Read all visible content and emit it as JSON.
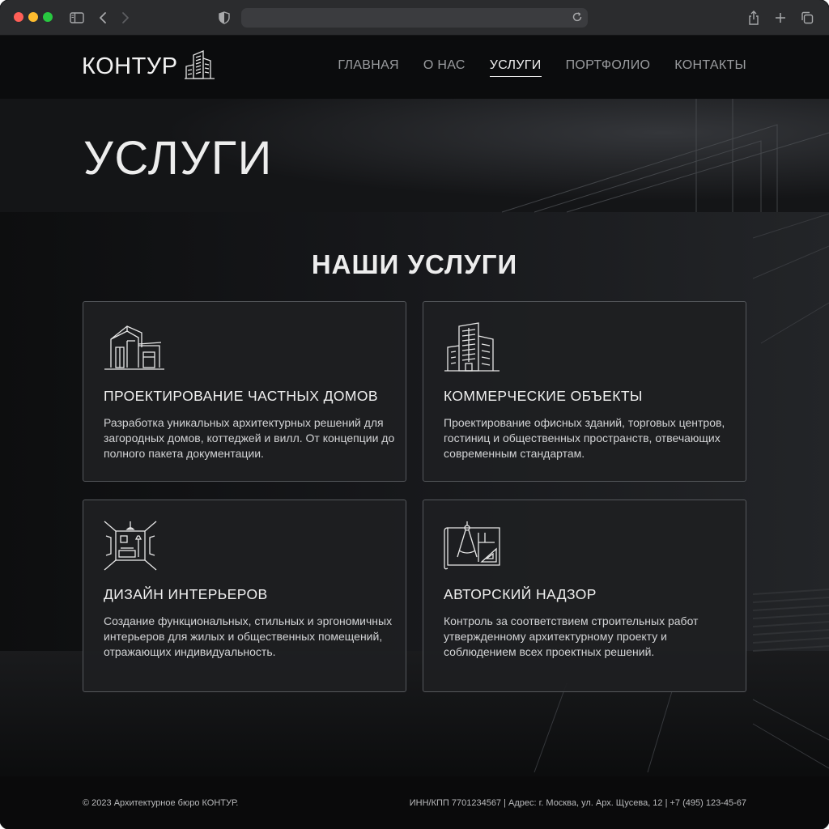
{
  "browser": {
    "url_text": ""
  },
  "header": {
    "logo_text": "КОНТУР",
    "nav": [
      {
        "label": "ГЛАВНАЯ",
        "active": false
      },
      {
        "label": "О НАС",
        "active": false
      },
      {
        "label": "УСЛУГИ",
        "active": true
      },
      {
        "label": "ПОРТФОЛИО",
        "active": false
      },
      {
        "label": "КОНТАКТЫ",
        "active": false
      }
    ]
  },
  "hero": {
    "title": "УСЛУГИ"
  },
  "services": {
    "title": "НАШИ УСЛУГИ",
    "items": [
      {
        "icon": "house-icon",
        "title": "ПРОЕКТИРОВАНИЕ ЧАСТНЫХ ДОМОВ",
        "text": "Разработка уникальных архитектурных решений для загородных домов, коттеджей и вилл. От концепции до полного пакета документации."
      },
      {
        "icon": "office-building-icon",
        "title": "КОММЕРЧЕСКИЕ ОБЪЕКТЫ",
        "text": "Проектирование офисных зданий, торговых центров, гостиниц и общественных пространств, отвечающих современным стандартам."
      },
      {
        "icon": "interior-room-icon",
        "title": "ДИЗАЙН ИНТЕРЬЕРОВ",
        "text": "Создание функциональных, стильных и эргономичных интерьеров для жилых и общественных помещений, отражающих индивидуальность."
      },
      {
        "icon": "blueprint-compass-icon",
        "title": "АВТОРСКИЙ НАДЗОР",
        "text": "Контроль за соответствием строительных работ утвержденному архитектурному проекту и соблюдением всех проектных решений."
      }
    ]
  },
  "footer": {
    "copyright": "© 2023 Архитектурное бюро КОНТУР.",
    "details": "ИНН/КПП 7701234567 | Адрес: г. Москва, ул. Арх. Щусева, 12 | +7 (495) 123-45-67"
  },
  "colors": {
    "background": "#0e0f10",
    "card": "#1e1f21",
    "card_border": "#55585c",
    "text": "#f0f0f0",
    "nav_inactive": "#9a9c9f"
  }
}
